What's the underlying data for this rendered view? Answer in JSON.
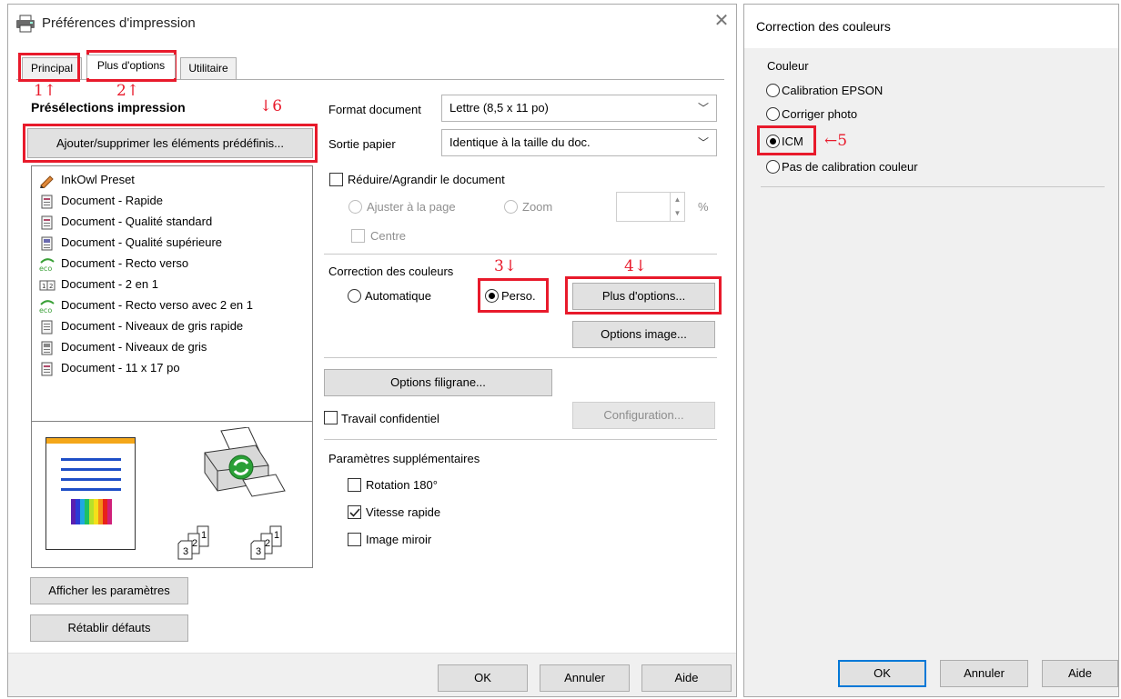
{
  "left_dialog": {
    "title": "Préférences d'impression",
    "tabs": [
      {
        "label": "Principal"
      },
      {
        "label": "Plus d'options"
      },
      {
        "label": "Utilitaire"
      }
    ],
    "presets": {
      "heading": "Présélections impression",
      "add_remove_label": "Ajouter/supprimer les éléments prédéfinis...",
      "items": [
        {
          "label": "InkOwl Preset",
          "icon": "pencil-icon"
        },
        {
          "label": "Document - Rapide",
          "icon": "document-icon"
        },
        {
          "label": "Document - Qualité standard",
          "icon": "document-icon"
        },
        {
          "label": "Document - Qualité supérieure",
          "icon": "document-icon"
        },
        {
          "label": "Document - Recto verso",
          "icon": "eco-icon"
        },
        {
          "label": "Document - 2 en 1",
          "icon": "two-in-one-icon"
        },
        {
          "label": "Document - Recto verso avec 2 en 1",
          "icon": "eco-icon"
        },
        {
          "label": "Document - Niveaux de gris rapide",
          "icon": "document-icon"
        },
        {
          "label": "Document - Niveaux de gris",
          "icon": "document-icon"
        },
        {
          "label": "Document - 11 x 17 po",
          "icon": "document-icon"
        }
      ]
    },
    "preview_sheets": [
      {
        "a": "1",
        "b": "2",
        "c": "3"
      },
      {
        "a": "1",
        "b": "2",
        "c": "3"
      }
    ],
    "show_settings_label": "Afficher les paramètres",
    "reset_defaults_label": "Rétablir défauts",
    "document_format": {
      "label": "Format document",
      "value": "Lettre (8,5 x 11 po)"
    },
    "paper_output": {
      "label": "Sortie papier",
      "value": "Identique à la taille du doc."
    },
    "reduce_enlarge": {
      "label": "Réduire/Agrandir le document",
      "checked": false
    },
    "fit_page_label": "Ajuster à la page",
    "zoom_label": "Zoom",
    "zoom_unit": "%",
    "center_label": "Centre",
    "color_correction": {
      "label": "Correction des couleurs",
      "auto_label": "Automatique",
      "custom_label": "Perso.",
      "more_options_label": "Plus d'options...",
      "image_options_label": "Options image..."
    },
    "watermark_label": "Options filigrane...",
    "confidential_label": "Travail confidentiel",
    "configuration_label": "Configuration...",
    "extra_params": {
      "heading": "Paramètres supplémentaires",
      "rotation_label": "Rotation 180°",
      "fast_speed_label": "Vitesse rapide",
      "mirror_label": "Image miroir"
    },
    "ok_label": "OK",
    "cancel_label": "Annuler",
    "help_label": "Aide"
  },
  "right_dialog": {
    "title": "Correction des couleurs",
    "group_label": "Couleur",
    "options": [
      {
        "label": "Calibration EPSON",
        "selected": false
      },
      {
        "label": "Corriger photo",
        "selected": false
      },
      {
        "label": "ICM",
        "selected": true
      },
      {
        "label": "Pas de calibration couleur",
        "selected": false
      }
    ],
    "ok_label": "OK",
    "cancel_label": "Annuler",
    "help_label": "Aide"
  },
  "annotations": {
    "a1": "1↑",
    "a2": "2↑",
    "a3": "3↓",
    "a4": "4↓",
    "a5": "←5",
    "a6": "↓6"
  },
  "colors": {
    "highlight": "#e81a2b",
    "accent": "#0078d7"
  }
}
